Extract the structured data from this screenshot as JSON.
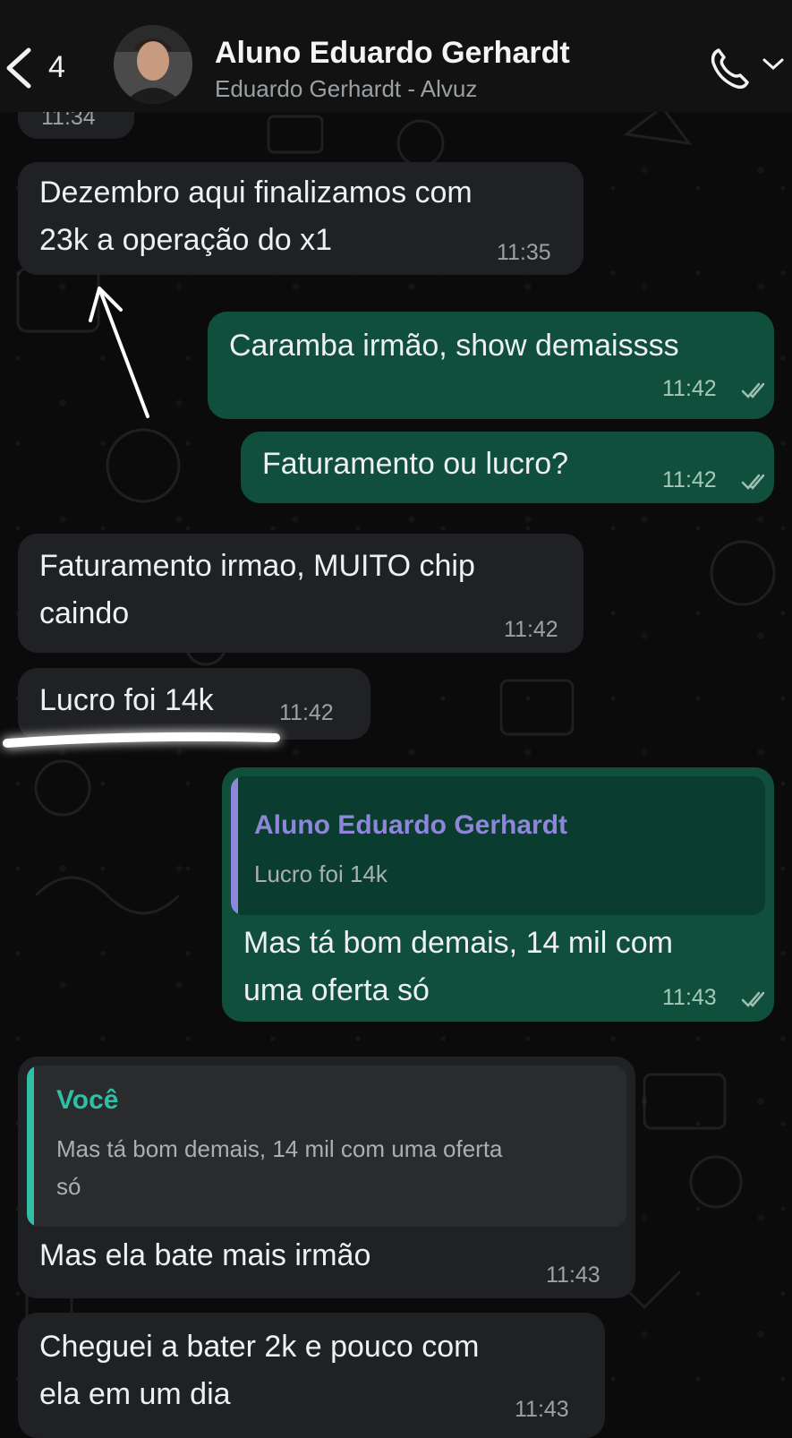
{
  "header": {
    "back_count": "4",
    "contact_name": "Aluno Eduardo Gerhardt",
    "contact_subtitle": "Eduardo Gerhardt - Alvuz"
  },
  "messages": [
    {
      "id": "m0",
      "direction": "in",
      "lines": [],
      "time": "11:34"
    },
    {
      "id": "m1",
      "direction": "in",
      "lines": [
        "Dezembro aqui finalizamos com",
        "23k a operação do x1"
      ],
      "time": "11:35"
    },
    {
      "id": "m2",
      "direction": "out",
      "lines": [
        "Caramba irmão, show demaissss"
      ],
      "time": "11:42",
      "status": "read"
    },
    {
      "id": "m3",
      "direction": "out",
      "lines": [
        "Faturamento ou lucro?"
      ],
      "time": "11:42",
      "status": "read"
    },
    {
      "id": "m4",
      "direction": "in",
      "lines": [
        "Faturamento irmao, MUITO chip",
        "caindo"
      ],
      "time": "11:42"
    },
    {
      "id": "m5",
      "direction": "in",
      "lines": [
        "Lucro foi 14k"
      ],
      "time": "11:42"
    },
    {
      "id": "m6",
      "direction": "out",
      "quote": {
        "author": "Aluno Eduardo Gerhardt",
        "text": [
          "Lucro foi 14k"
        ],
        "color": "#8f86d9"
      },
      "lines": [
        "Mas tá bom demais, 14 mil com",
        "uma oferta só"
      ],
      "time": "11:43",
      "status": "read"
    },
    {
      "id": "m7",
      "direction": "in",
      "quote": {
        "author": "Você",
        "text": [
          "Mas tá bom demais, 14 mil com uma oferta",
          "só"
        ],
        "color": "#2fbfa5"
      },
      "lines": [
        "Mas ela bate mais irmão"
      ],
      "time": "11:43"
    },
    {
      "id": "m8",
      "direction": "in",
      "lines": [
        "Cheguei a bater 2k e pouco com",
        "ela em um dia"
      ],
      "time": "11:43"
    }
  ],
  "colors": {
    "incoming_bubble": "#202124",
    "outgoing_bubble": "#0f4f3c",
    "read_ticks": "#9fbfb4"
  },
  "icons": [
    "chevron-left-icon",
    "phone-icon",
    "chevron-down-icon",
    "double-check-icon"
  ]
}
